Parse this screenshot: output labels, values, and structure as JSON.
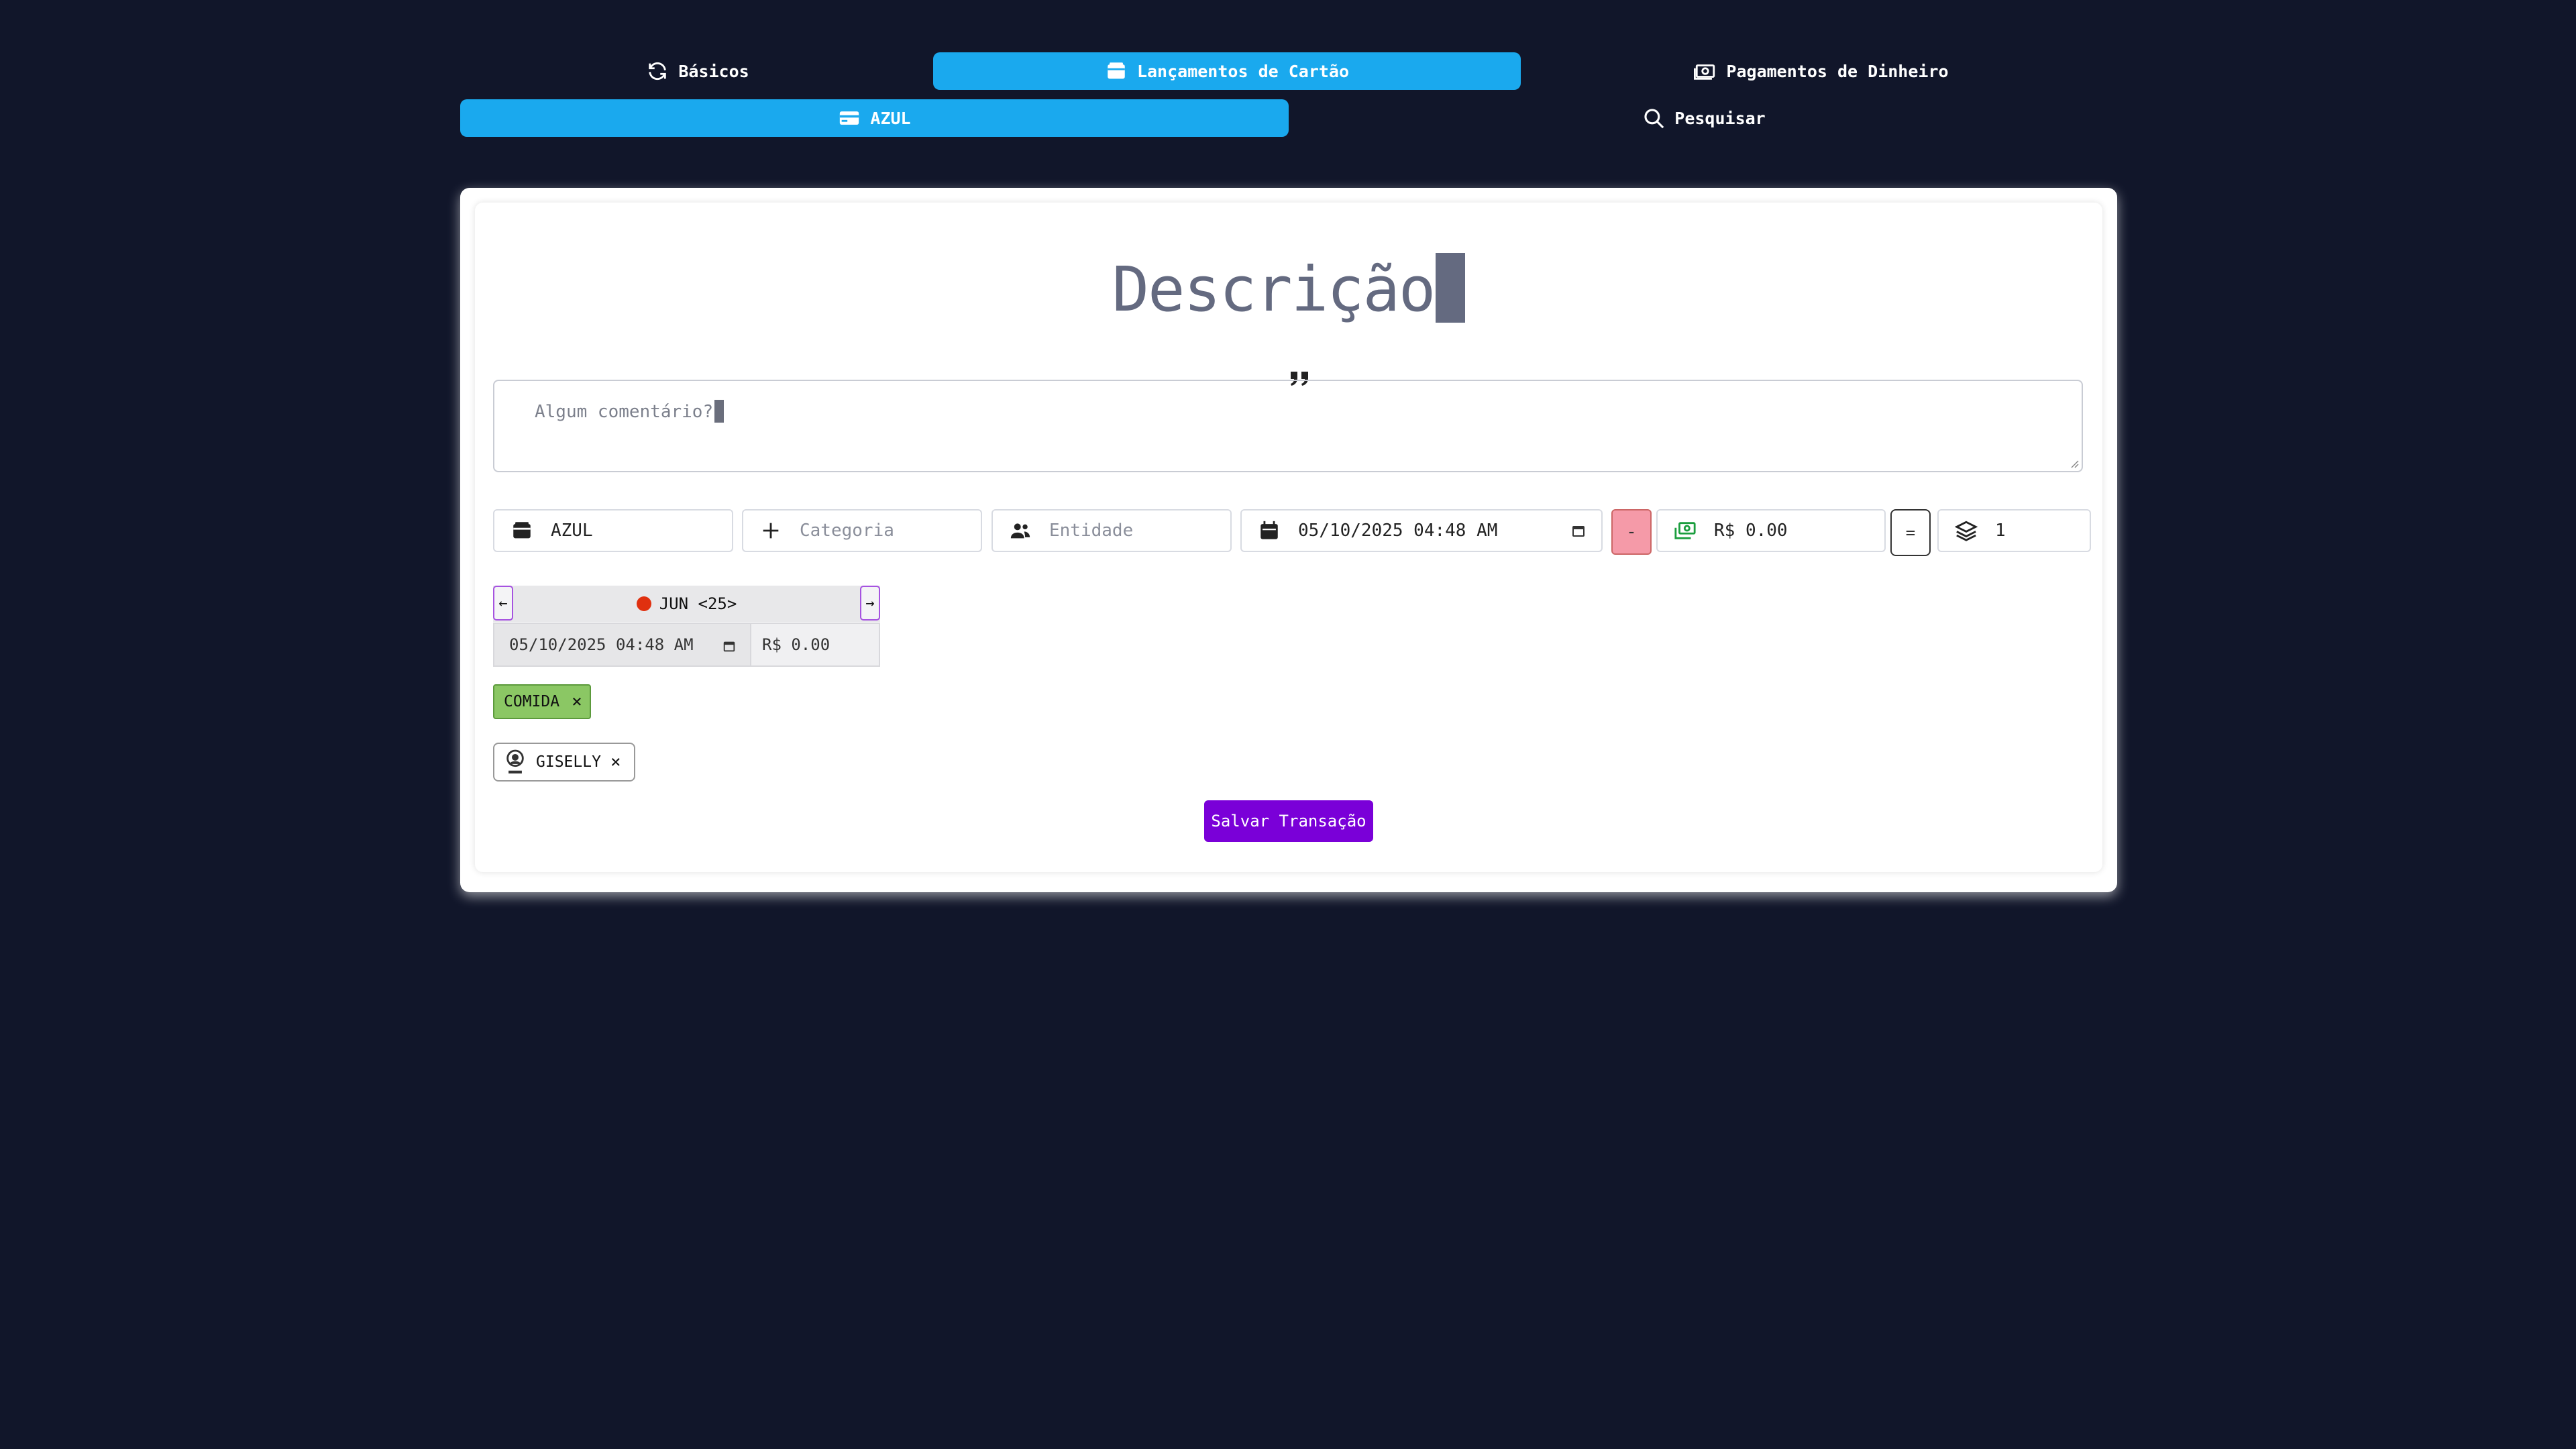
{
  "nav": {
    "tabs": [
      {
        "label": "Básicos",
        "icon": "refresh-icon"
      },
      {
        "label": "Lançamentos de Cartão",
        "icon": "card-wallet-icon"
      },
      {
        "label": "Pagamentos de Dinheiro",
        "icon": "money-icon"
      }
    ],
    "subtabs": [
      {
        "label": "AZUL",
        "icon": "credit-card-icon"
      },
      {
        "label": "Pesquisar",
        "icon": "search-icon"
      }
    ]
  },
  "form": {
    "title": "Descrição",
    "comment_placeholder": "Algum comentário?",
    "wallet": "AZUL",
    "category_placeholder": "Categoria",
    "entity_placeholder": "Entidade",
    "datetime": "05/10/2025 04:48 AM",
    "sign_label": "-",
    "amount": "R$ 0.00",
    "equals_label": "=",
    "installments": "1"
  },
  "installment": {
    "prev": "←",
    "next": "→",
    "month": "JUN <25>",
    "date": "05/10/2025 04:48 AM",
    "value": "R$ 0.00"
  },
  "tags": {
    "category": "COMIDA",
    "entity": "GISELLY",
    "remove_symbol": "×"
  },
  "save_label": "Salvar Transação",
  "colors": {
    "background": "#11162a",
    "accent": "#1aa9ee",
    "save": "#7a00d8",
    "category_chip": "#8bc764",
    "minus": "#f59aa8",
    "status_dot": "#e0300f"
  }
}
